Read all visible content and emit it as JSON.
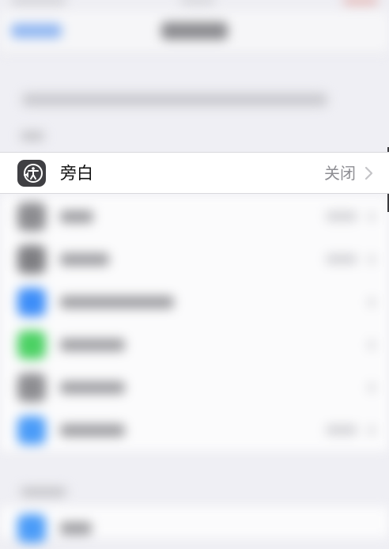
{
  "colors": {
    "background": "#efeff4",
    "row_background": "#ffffff",
    "icon_background": "#3f3f43",
    "value_text": "#8e8e93",
    "label_text": "#111111",
    "accent": "#007aff"
  },
  "focused_row": {
    "icon": "audio-description-icon",
    "label": "旁白",
    "value": "关闭"
  },
  "blurred_rows": [
    {
      "icon_color": "#8d8d91"
    },
    {
      "icon_color": "#7f7f83"
    },
    {
      "icon_color": "#3e8ef8"
    },
    {
      "icon_color": "#4cd164"
    },
    {
      "icon_color": "#8e8e92"
    },
    {
      "icon_color": "#4b9cf8"
    }
  ]
}
